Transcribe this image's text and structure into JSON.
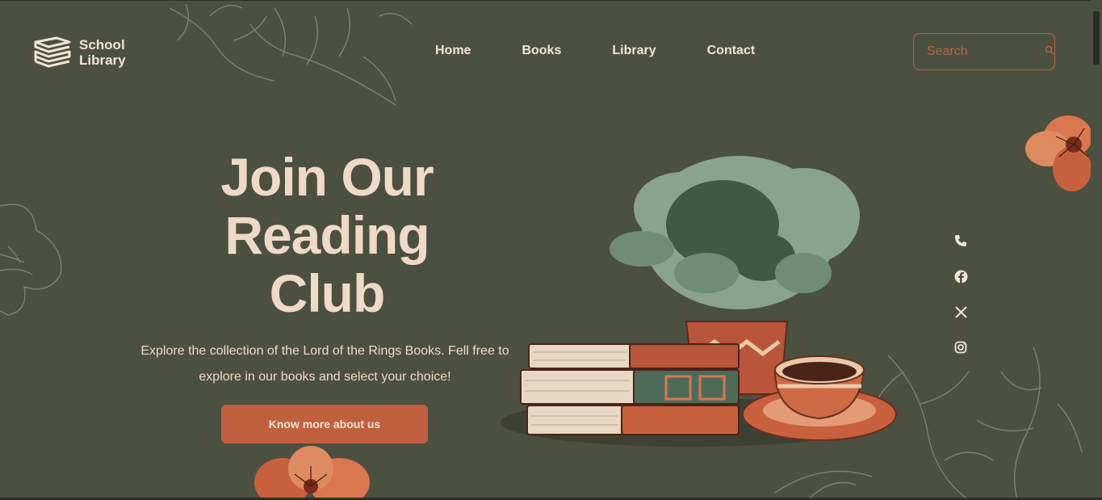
{
  "brand": {
    "line1": "School",
    "line2": "Library"
  },
  "nav": {
    "items": [
      {
        "label": "Home"
      },
      {
        "label": "Books"
      },
      {
        "label": "Library"
      },
      {
        "label": "Contact"
      }
    ]
  },
  "search": {
    "placeholder": "Search"
  },
  "hero": {
    "title_line1": "Join Our",
    "title_line2": "Reading",
    "title_line3": "Club",
    "description_line1": "Explore the collection of the Lord of the Rings Books. Fell free to",
    "description_line2": "explore in our books and select your choice!",
    "cta_label": "Know more about us"
  },
  "social": {
    "icons": [
      "phone-icon",
      "facebook-icon",
      "x-icon",
      "instagram-icon"
    ]
  },
  "colors": {
    "background": "#4c5040",
    "accent": "#c0603f",
    "text": "#efdac7"
  }
}
